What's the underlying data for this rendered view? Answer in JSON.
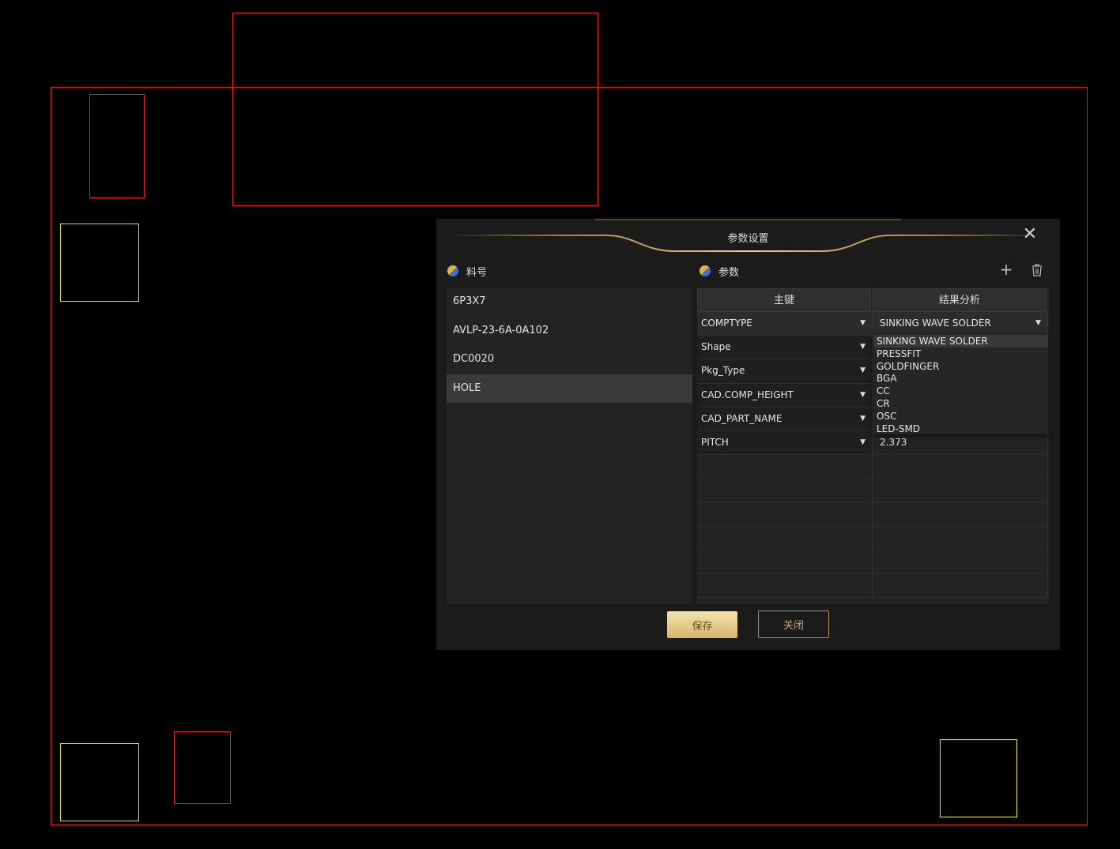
{
  "dialog": {
    "title": "参数设置",
    "close_icon": "close-icon"
  },
  "left_panel": {
    "header": "料号",
    "items": [
      "6P3X7",
      "AVLP-23-6A-0A102",
      "DC0020",
      "HOLE"
    ],
    "selected_index": 3
  },
  "right_panel": {
    "header": "参数",
    "add_icon": "plus-icon",
    "delete_icon": "trash-icon",
    "columns": [
      "主键",
      "结果分析"
    ],
    "rows": [
      {
        "key": "COMPTYPE",
        "value": "SINKING WAVE SOLDER"
      },
      {
        "key": "Shape",
        "value": ""
      },
      {
        "key": "Pkg_Type",
        "value": ""
      },
      {
        "key": "CAD.COMP_HEIGHT",
        "value": ""
      },
      {
        "key": "CAD_PART_NAME",
        "value": ""
      },
      {
        "key": "PITCH",
        "value": "2.373"
      }
    ],
    "dropdown_options": [
      "SINKING WAVE SOLDER",
      "PRESSFIT",
      "GOLDFINGER",
      "BGA",
      "CC",
      "CR",
      "OSC",
      "LED-SMD"
    ]
  },
  "buttons": {
    "save": "保存",
    "close": "关闭"
  },
  "colors": {
    "outline_red": "#e01f1f",
    "outline_yellow": "#e6e02a",
    "gold_accent": "#c8a45a",
    "dialog_bg": "#1b1b1b"
  }
}
